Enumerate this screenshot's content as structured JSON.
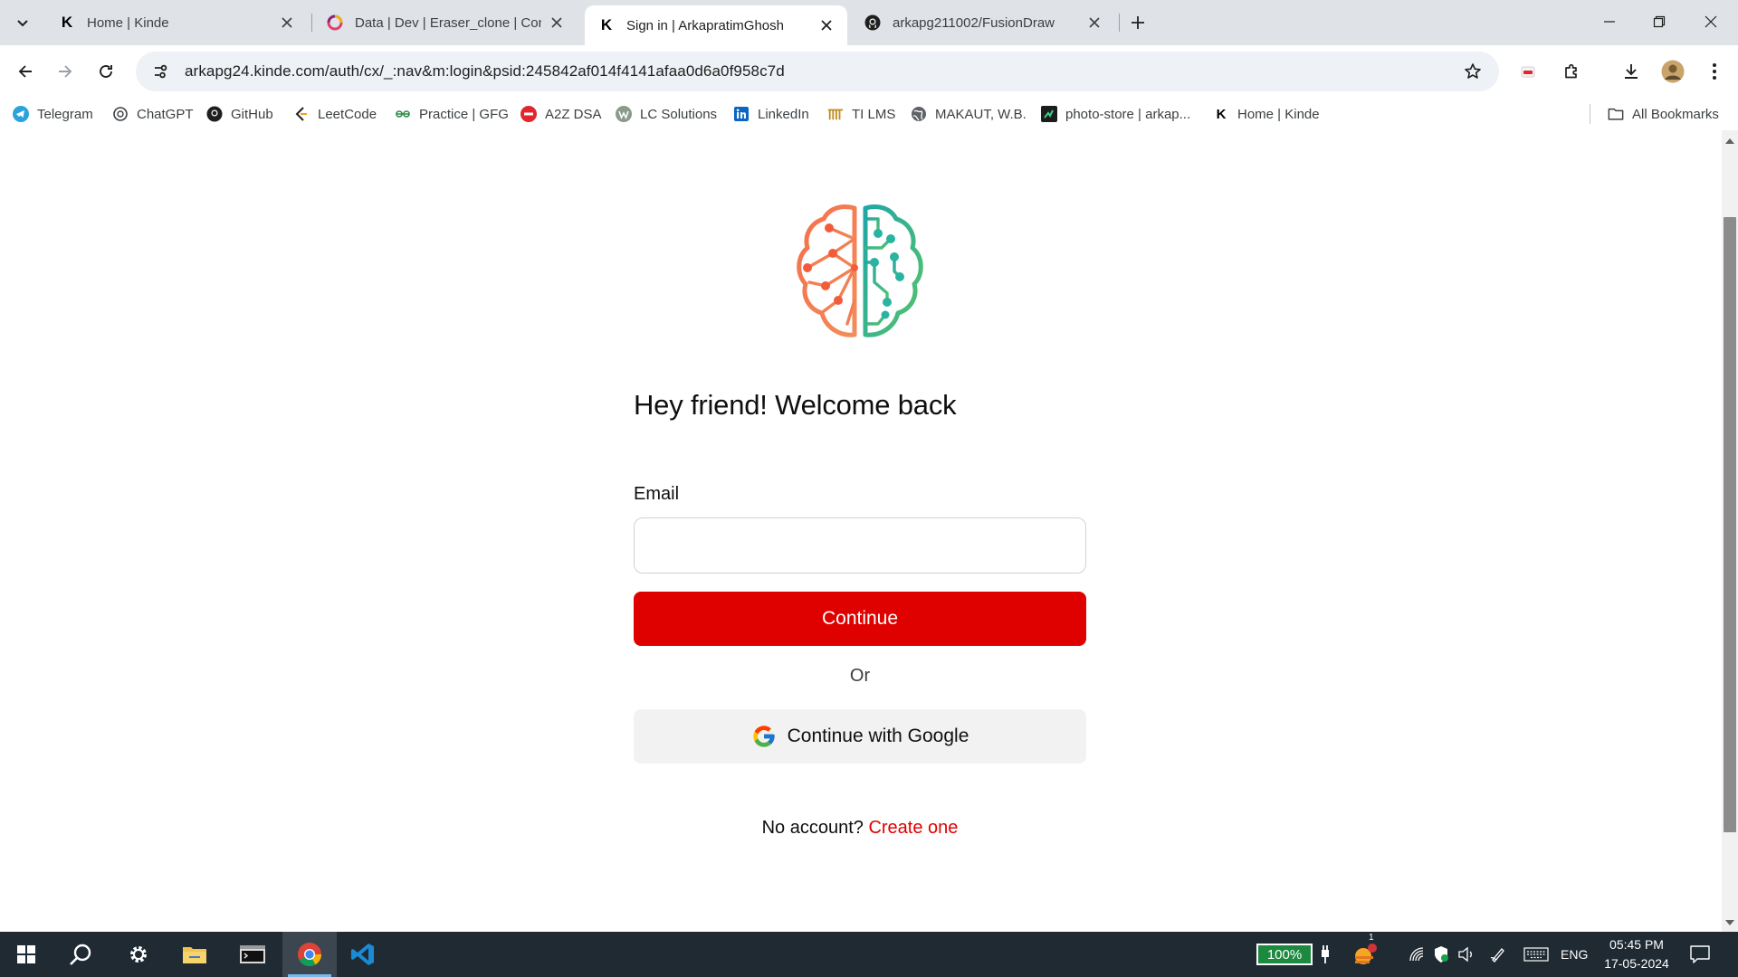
{
  "browser": {
    "tabs": [
      {
        "title": "Home | Kinde",
        "favicon": "kinde-k-icon"
      },
      {
        "title": "Data | Dev | Eraser_clone | Conv",
        "favicon": "convex-icon"
      },
      {
        "title": "Sign in | ArkapratimGhosh",
        "favicon": "kinde-k-icon",
        "active": true
      },
      {
        "title": "arkapg211002/FusionDraw",
        "favicon": "github-icon"
      }
    ],
    "favicon_letter": "K",
    "address": "arkapg24.kinde.com/auth/cx/_:nav&m:login&psid:245842af014f4141afaa0d6a0f958c7d",
    "bookmarks": [
      {
        "label": "Telegram",
        "icon": "telegram-icon"
      },
      {
        "label": "ChatGPT",
        "icon": "chatgpt-icon"
      },
      {
        "label": "GitHub",
        "icon": "github-icon"
      },
      {
        "label": "LeetCode",
        "icon": "leetcode-icon"
      },
      {
        "label": "Practice | GFG",
        "icon": "gfg-icon"
      },
      {
        "label": "A2Z DSA",
        "icon": "tuf-icon"
      },
      {
        "label": "LC Solutions",
        "icon": "lc-solutions-icon"
      },
      {
        "label": "LinkedIn",
        "icon": "linkedin-icon"
      },
      {
        "label": "TI LMS",
        "icon": "ti-lms-icon"
      },
      {
        "label": "MAKAUT, W.B.",
        "icon": "globe-icon"
      },
      {
        "label": "photo-store | arkap...",
        "icon": "photo-store-icon"
      },
      {
        "label": "Home | Kinde",
        "icon": "kinde-k-icon"
      }
    ],
    "all_bookmarks_label": "All Bookmarks"
  },
  "login": {
    "heading": "Hey friend! Welcome back",
    "email_label": "Email",
    "email_value": "",
    "continue_label": "Continue",
    "or_label": "Or",
    "google_label": "Continue with Google",
    "no_account_text": "No account?",
    "create_link": "Create one"
  },
  "colors": {
    "accent": "#df0000",
    "logo_left": "#f25c3b",
    "logo_right": "#2ab3a0"
  },
  "taskbar": {
    "apps": [
      "windows-start-icon",
      "search-icon",
      "settings-icon",
      "file-explorer-icon",
      "terminal-icon",
      "chrome-icon",
      "vscode-icon"
    ],
    "battery": "100%",
    "weather_badge": "1",
    "language": "ENG",
    "time": "05:45 PM",
    "date": "17-05-2024"
  }
}
